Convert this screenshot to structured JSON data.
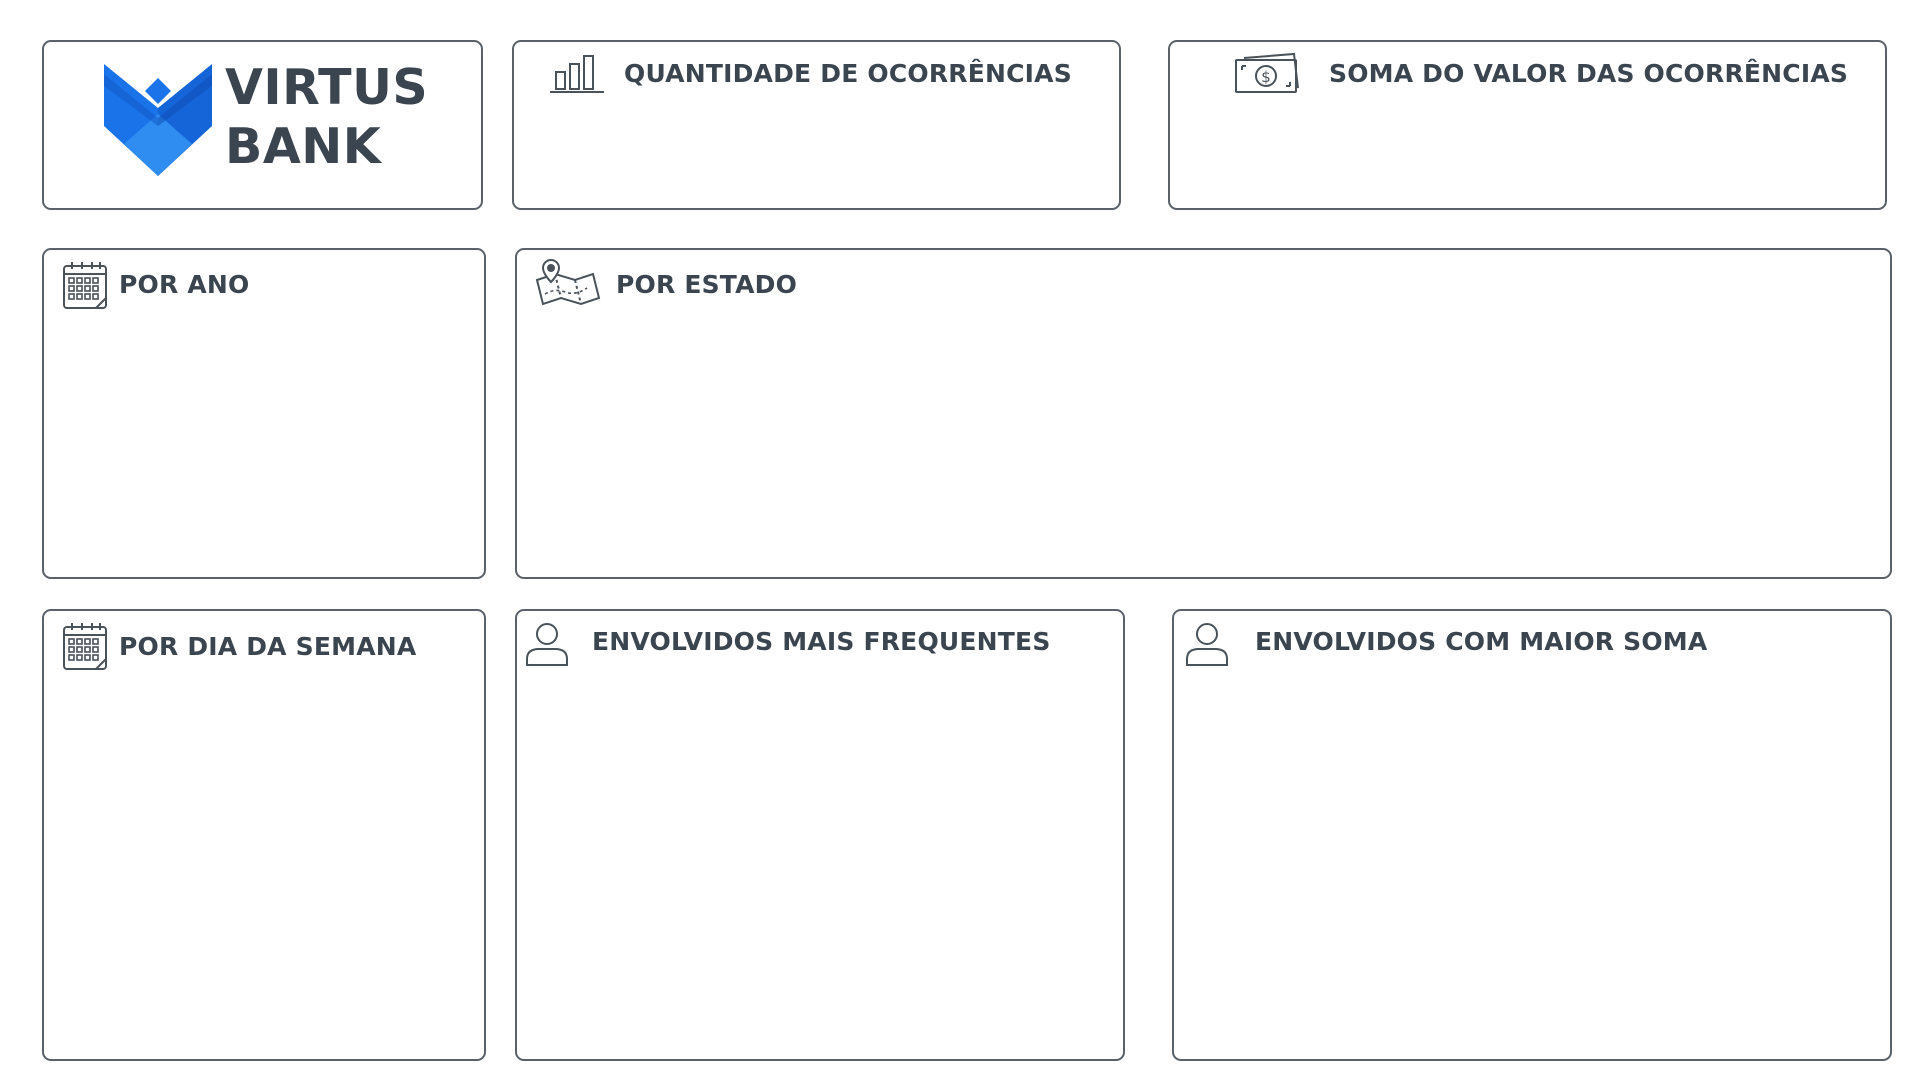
{
  "brand": {
    "line1": "VIRTUS",
    "line2": "BANK",
    "logo_icon": "virtus-bank-logo",
    "colors": {
      "accent_blue": "#1a73e8",
      "dark_blue": "#1259c9",
      "text": "#3a4550",
      "border": "#5b6168"
    }
  },
  "cards": {
    "quantity": {
      "title": "QUANTIDADE DE OCORRÊNCIAS",
      "icon": "bar-chart-icon"
    },
    "sum_value": {
      "title": "SOMA DO VALOR DAS OCORRÊNCIAS",
      "icon": "money-bill-icon"
    },
    "by_year": {
      "title": "POR ANO",
      "icon": "calendar-icon"
    },
    "by_state": {
      "title": "POR ESTADO",
      "icon": "map-pin-icon"
    },
    "by_weekday": {
      "title": "POR DIA DA SEMANA",
      "icon": "calendar-icon"
    },
    "top_frequent": {
      "title": "ENVOLVIDOS MAIS FREQUENTES",
      "icon": "user-icon"
    },
    "top_sum": {
      "title": "ENVOLVIDOS COM MAIOR SOMA",
      "icon": "user-icon"
    }
  }
}
